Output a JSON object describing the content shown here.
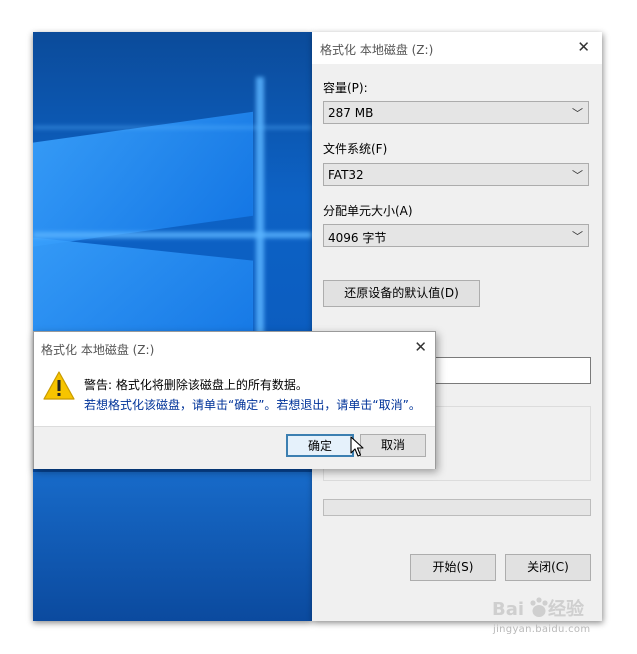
{
  "format_window": {
    "title": "格式化 本地磁盘 (Z:)",
    "capacity_label": "容量(P):",
    "capacity_value": "287 MB",
    "filesystem_label": "文件系统(F)",
    "filesystem_value": "FAT32",
    "allocation_label": "分配单元大小(A)",
    "allocation_value": "4096 字节",
    "restore_defaults_button": "还原设备的默认值(D)",
    "start_button": "开始(S)",
    "close_button": "关闭(C)"
  },
  "warning_dialog": {
    "title": "格式化 本地磁盘 (Z:)",
    "line1": "警告: 格式化将删除该磁盘上的所有数据。",
    "line2": "若想格式化该磁盘，请单击“确定”。若想退出，请单击“取消”。",
    "ok_button": "确定",
    "cancel_button": "取消"
  },
  "icons": {
    "close": "close-icon",
    "dropdown": "chevron-down-icon",
    "warning": "warning-icon",
    "cursor": "mouse-cursor-icon"
  },
  "watermark": {
    "logo_text": "Baidu经验",
    "url": "jingyan.baidu.com"
  },
  "colors": {
    "wallpaper": "#0d62c5",
    "warning_yellow": "#f7c400",
    "ok_button_border": "#3c7fb1"
  }
}
